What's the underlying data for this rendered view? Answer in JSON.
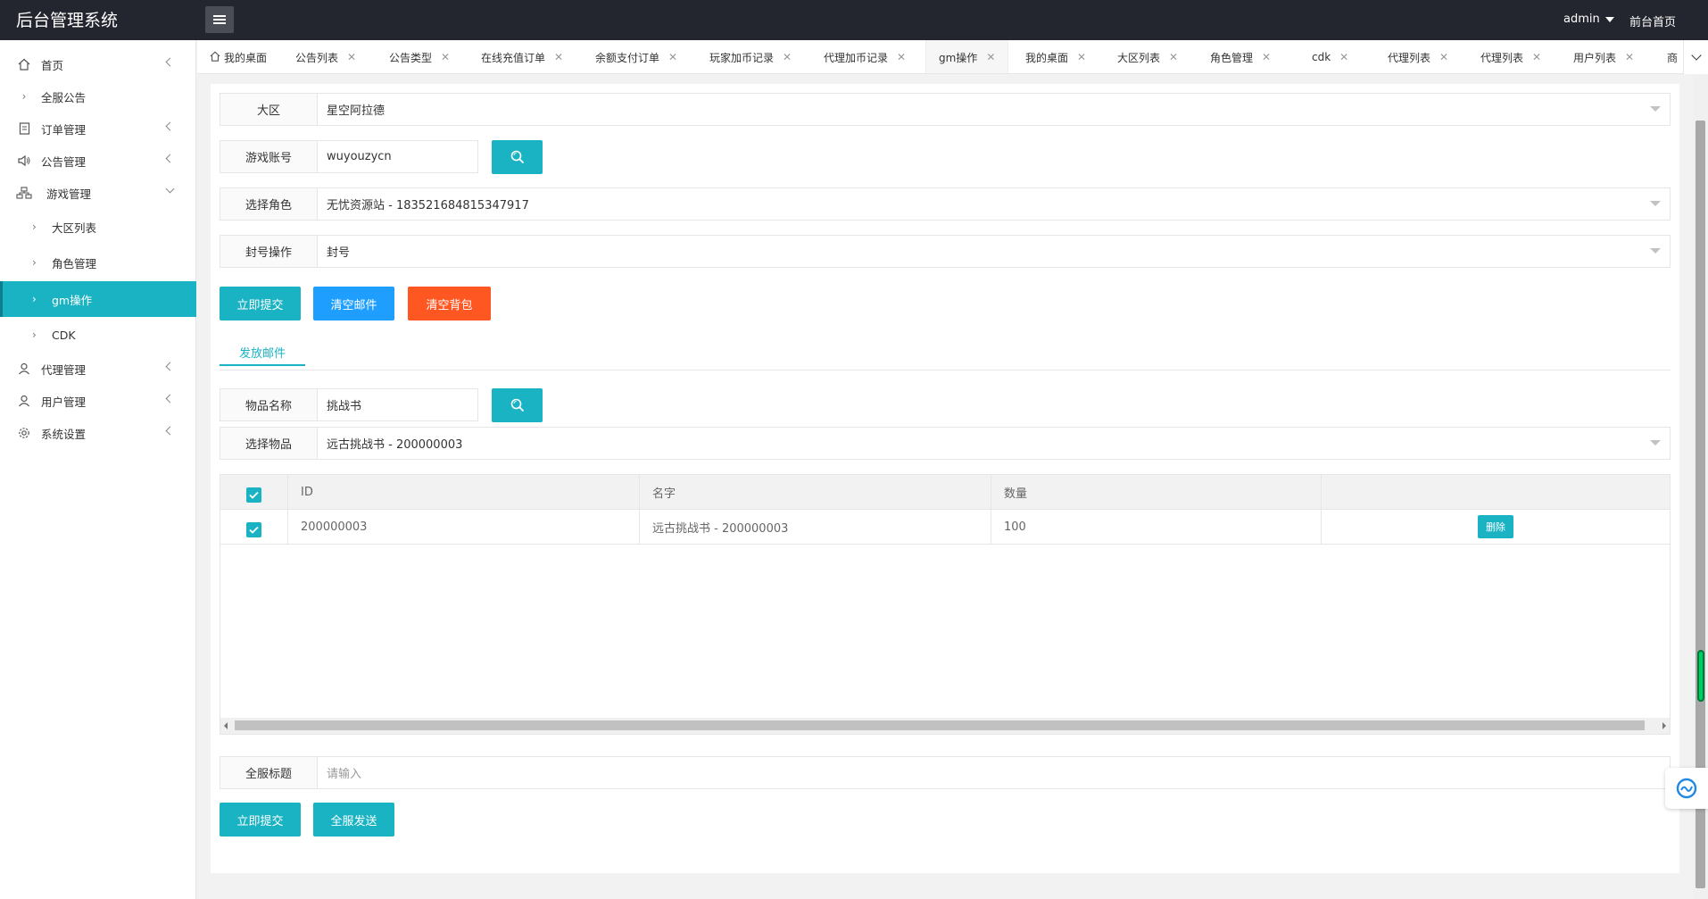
{
  "header": {
    "app_title": "后台管理系统",
    "user_name": "admin",
    "front_link": "前台首页"
  },
  "sidebar": {
    "items": [
      {
        "label": "首页",
        "icon": "home-icon",
        "expandable": true
      },
      {
        "label": "全服公告",
        "icon": "chevron-right-icon",
        "expandable": false
      },
      {
        "label": "订单管理",
        "icon": "document-icon",
        "expandable": true
      },
      {
        "label": "公告管理",
        "icon": "speaker-icon",
        "expandable": true
      },
      {
        "label": "游戏管理",
        "icon": "sitemap-icon",
        "expanded": true
      },
      {
        "label": "大区列表",
        "icon": "chevron-right-icon",
        "sub": true
      },
      {
        "label": "角色管理",
        "icon": "chevron-right-icon",
        "sub": true
      },
      {
        "label": "gm操作",
        "icon": "chevron-right-icon",
        "sub": true,
        "active": true
      },
      {
        "label": "CDK",
        "icon": "chevron-right-icon",
        "sub": true
      },
      {
        "label": "代理管理",
        "icon": "user-icon",
        "expandable": true
      },
      {
        "label": "用户管理",
        "icon": "user-icon",
        "expandable": true
      },
      {
        "label": "系统设置",
        "icon": "gear-icon",
        "expandable": true
      }
    ]
  },
  "tabs": [
    {
      "label": "我的桌面",
      "closable": false
    },
    {
      "label": "公告列表",
      "closable": true
    },
    {
      "label": "公告类型",
      "closable": true
    },
    {
      "label": "在线充值订单",
      "closable": true
    },
    {
      "label": "余额支付订单",
      "closable": true
    },
    {
      "label": "玩家加币记录",
      "closable": true
    },
    {
      "label": "代理加币记录",
      "closable": true
    },
    {
      "label": "gm操作",
      "closable": true,
      "active": true
    },
    {
      "label": "我的桌面",
      "closable": true
    },
    {
      "label": "大区列表",
      "closable": true
    },
    {
      "label": "角色管理",
      "closable": true
    },
    {
      "label": "cdk",
      "closable": true
    },
    {
      "label": "代理列表",
      "closable": true
    },
    {
      "label": "代理列表",
      "closable": true
    },
    {
      "label": "用户列表",
      "closable": true
    },
    {
      "label": "商",
      "closable": false
    }
  ],
  "form": {
    "region": {
      "label": "大区",
      "value": "星空阿拉德"
    },
    "account": {
      "label": "游戏账号",
      "value": "wuyouzycn"
    },
    "role": {
      "label": "选择角色",
      "value": "无忧资源站 - 183521684815347917"
    },
    "ban": {
      "label": "封号操作",
      "value": "封号"
    },
    "buttons": {
      "submit": "立即提交",
      "clear_mail": "清空邮件",
      "clear_bag": "清空背包"
    }
  },
  "mail": {
    "subtab": "发放邮件",
    "item_name": {
      "label": "物品名称",
      "value": "挑战书"
    },
    "item_select": {
      "label": "选择物品",
      "value": "远古挑战书 - 200000003"
    },
    "table": {
      "columns": [
        "ID",
        "名字",
        "数量",
        ""
      ],
      "rows": [
        {
          "id": "200000003",
          "name": "远古挑战书 - 200000003",
          "qty": "100",
          "action": "删除"
        }
      ]
    },
    "title": {
      "label": "全服标题",
      "placeholder": "请输入"
    },
    "buttons": {
      "submit": "立即提交",
      "send_all": "全服发送"
    }
  },
  "colors": {
    "accent": "#1ab3c4",
    "blue": "#1e9fff",
    "orange": "#ff5722",
    "header": "#23262e"
  }
}
